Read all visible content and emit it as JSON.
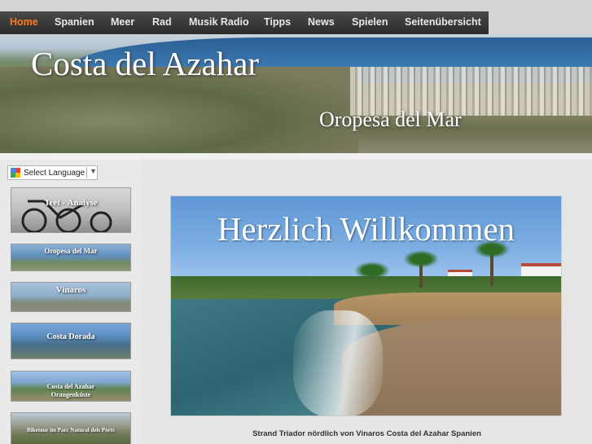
{
  "nav": {
    "items": [
      {
        "label": "Home",
        "active": true
      },
      {
        "label": "Spanien"
      },
      {
        "label": "Meer"
      },
      {
        "label": "Rad"
      },
      {
        "label": "Musik Radio"
      },
      {
        "label": "Tipps"
      },
      {
        "label": "News"
      },
      {
        "label": "Spielen"
      },
      {
        "label": "Seitenübersicht"
      }
    ],
    "active_color": "#ff7b1c"
  },
  "header": {
    "title": "Costa del Azahar",
    "subtitle": "Oropesa del Mar"
  },
  "sidebar": {
    "language_select": {
      "label": "Select Language",
      "icon": "google-translate-icon",
      "arrow": "▼"
    },
    "thumbs": [
      {
        "label": "Tret - Analyse"
      },
      {
        "label": "Oropesa del Mar"
      },
      {
        "label": "Vinaros"
      },
      {
        "label": "Costa Dorada"
      },
      {
        "label": "Costa del Azahar",
        "label2": "Orangenküste"
      },
      {
        "label": "Biketour im Parc Natural dels Ports"
      }
    ]
  },
  "main": {
    "hero_title": "Herzlich Willkommen",
    "caption": "Strand Triador nördlich von Vinaros Costa del Azahar Spanien"
  }
}
